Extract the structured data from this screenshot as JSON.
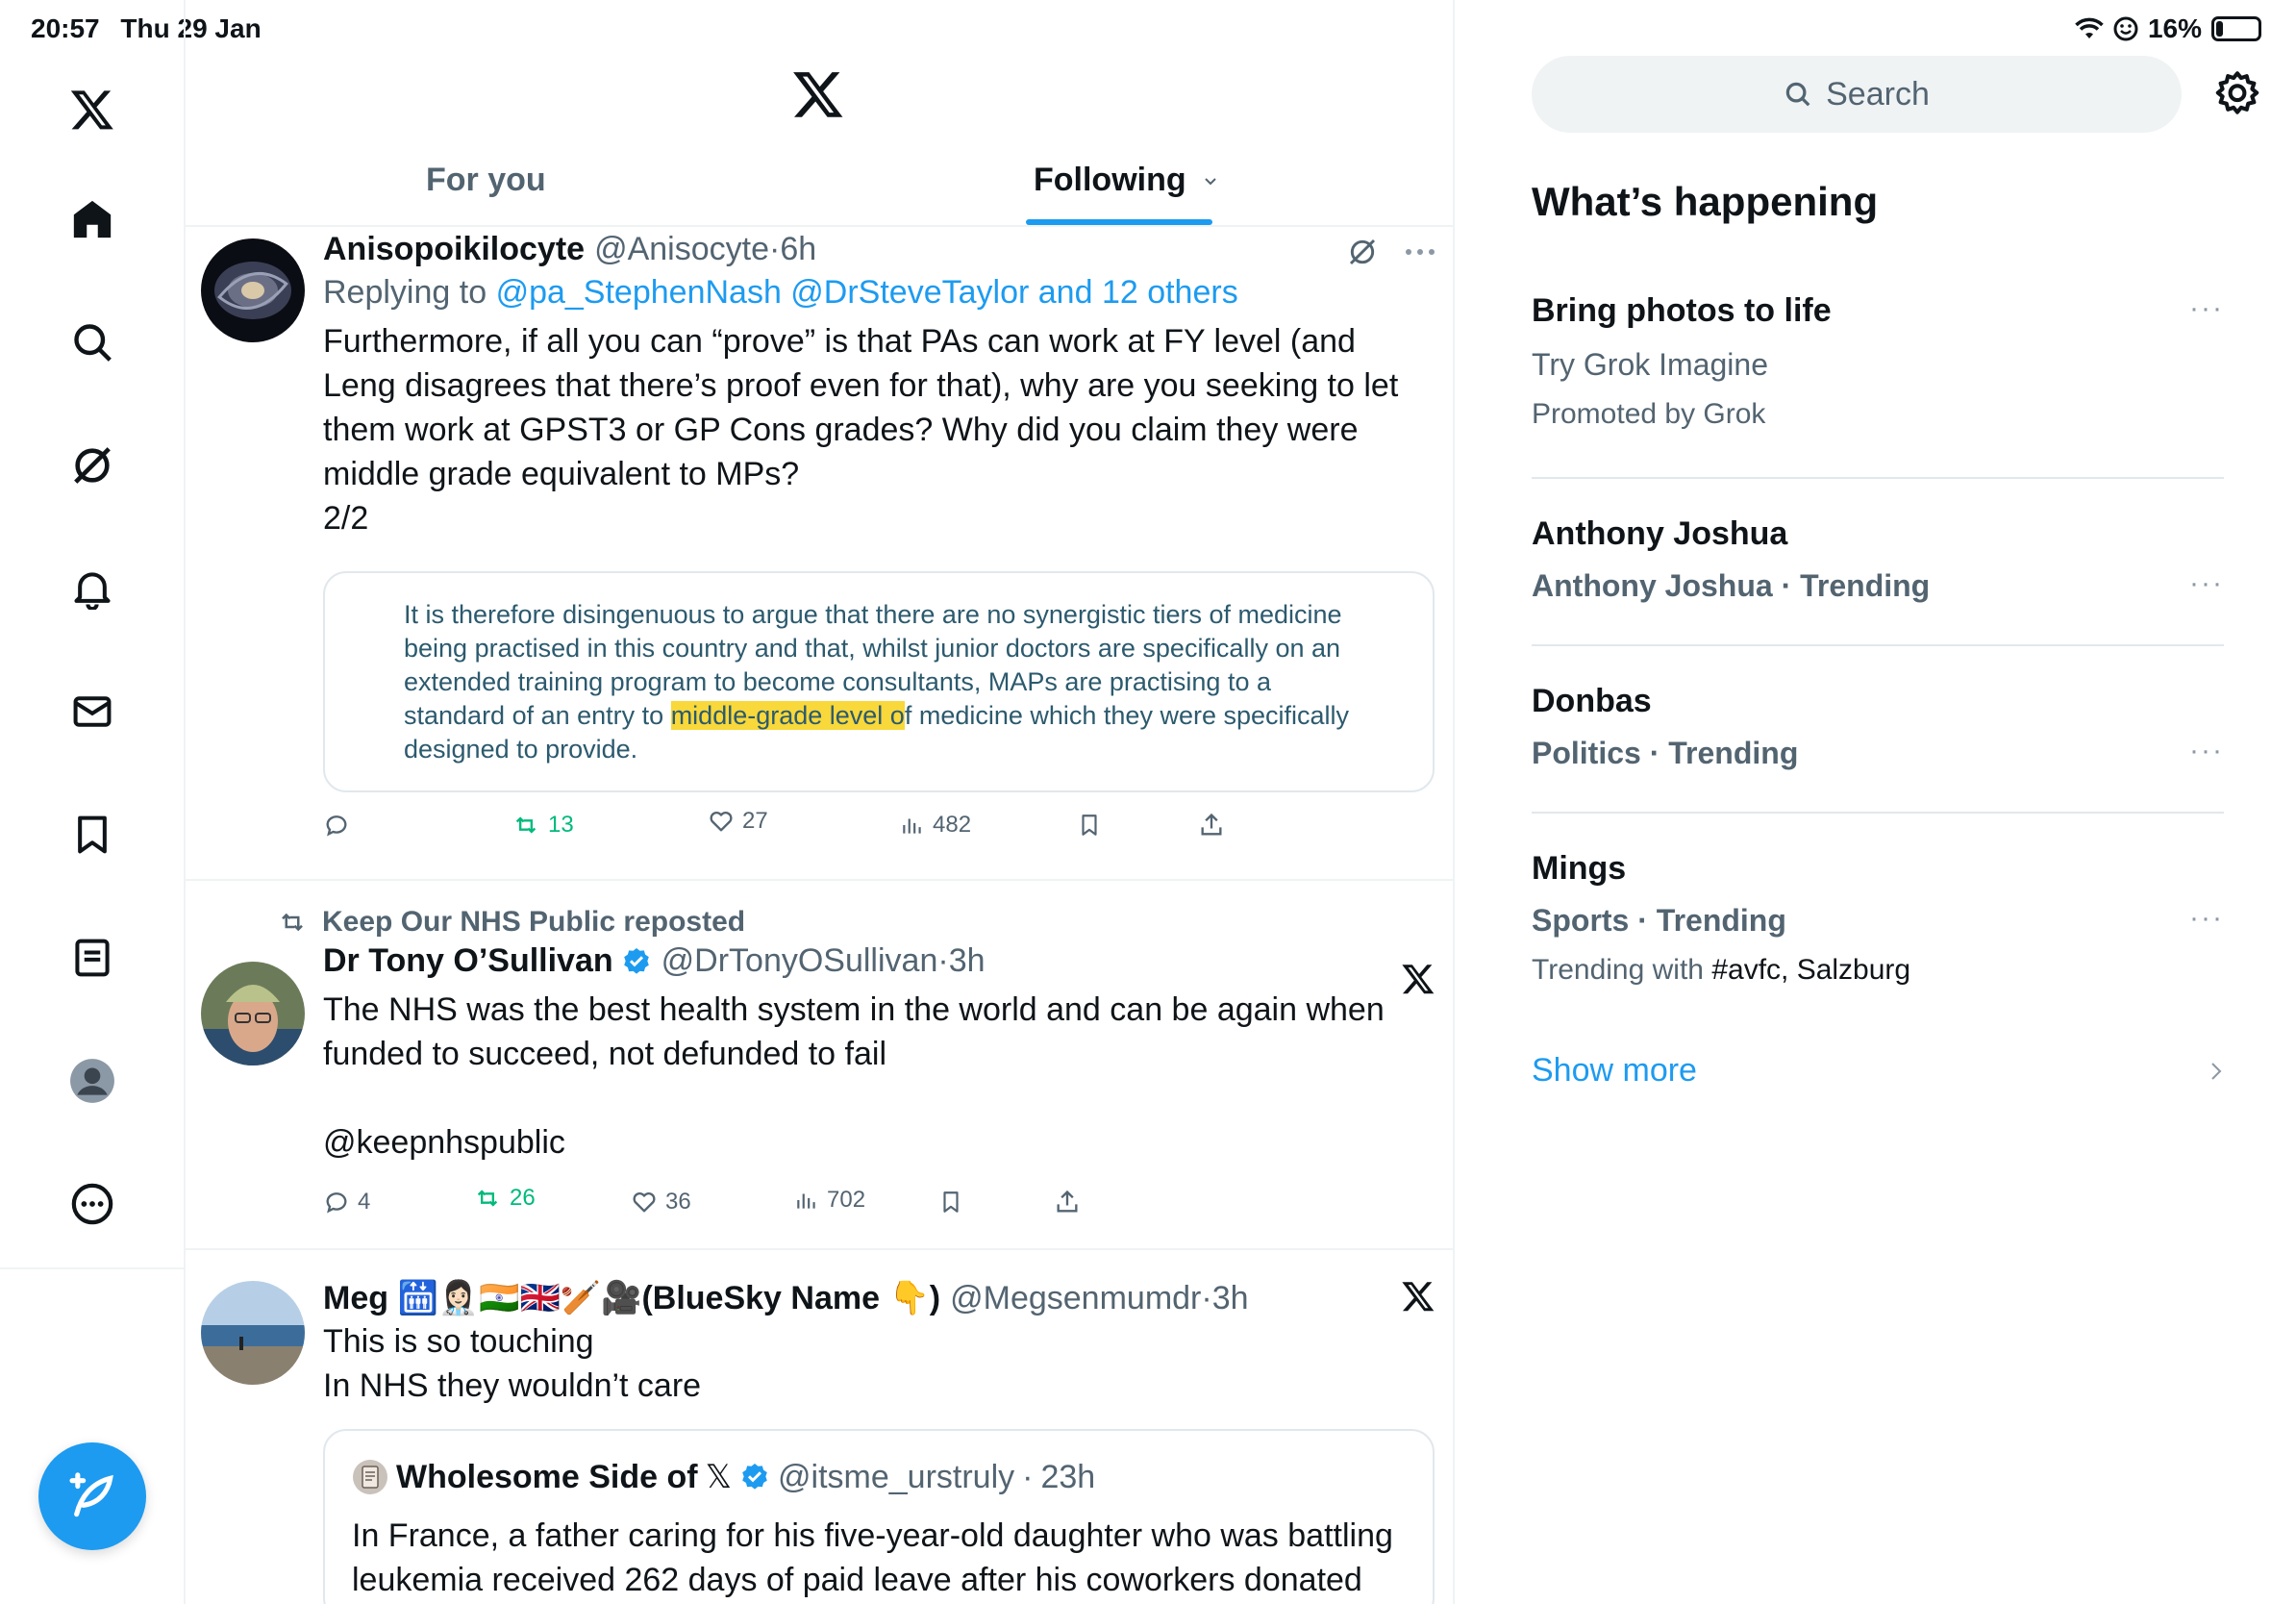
{
  "status_bar": {
    "time": "20:57",
    "date": "Thu 29 Jan",
    "battery": "16%",
    "battery_level": 0.16
  },
  "tabs": [
    {
      "label": "For you"
    },
    {
      "label": "Following"
    }
  ],
  "tweets": [
    {
      "name": "Anisopoikilocyte",
      "handle": "@Anisocyte",
      "time": "6h",
      "reply_prefix": "Replying to",
      "reply_to": "@pa_StephenNash @DrSteveTaylor and 12 others",
      "text": "Furthermore, if all you can “prove” is that PAs can work at FY level (and Leng disagrees that there’s proof even for that), why are you seeking to let them work at GPST3 or GP Cons grades? Why did you claim they were middle grade equivalent to MPs?",
      "text2": "2/2",
      "image_text_before": "It is therefore disingenuous to argue that there are no synergistic tiers of medicine being practised in this country and that, whilst junior doctors are specifically on an extended training program to become consultants, MAPs are practising to a standard of an entry to ",
      "image_text_highlight": "middle-grade level o",
      "image_text_after": "f medicine which they were specifically designed to provide.",
      "reposts": "13",
      "likes": "27",
      "views": "482"
    },
    {
      "reposted_by": "Keep Our NHS Public reposted",
      "name": "Dr Tony O’Sullivan",
      "handle": "@DrTonyOSullivan",
      "time": "3h",
      "text": "The NHS was the best health system in the world and can be again when funded to succeed, not defunded to fail",
      "mention": "@keepnhspublic",
      "replies": "4",
      "reposts": "26",
      "likes": "36",
      "views": "702"
    },
    {
      "name": "Meg 🛗👩🏻‍⚕️🇮🇳🇬🇧🏏🎥(BlueSky Name 👇)",
      "handle": "@Megsenmumdr",
      "time": "3h",
      "text1": "This is so touching",
      "text2": "In NHS they wouldn’t care",
      "quote": {
        "name": "Wholesome Side of",
        "name_suffix": "𝕏",
        "handle": "@itsme_urstruly",
        "time": "23h",
        "text": "In France, a father caring for his five-year-old daughter who was battling leukemia received 262 days of paid leave after his coworkers donated"
      }
    }
  ],
  "sidebar": {
    "search_placeholder": "Search",
    "title": "What’s happening",
    "trends": [
      {
        "title": "Bring photos to life",
        "sub": "Try Grok Imagine",
        "meta": "Promoted by Grok"
      },
      {
        "title": "Anthony Joshua",
        "sub": "Anthony Joshua · Trending"
      },
      {
        "title": "Donbas",
        "sub": "Politics · Trending"
      },
      {
        "title": "Mings",
        "sub": "Sports · Trending",
        "meta_prefix": "Trending with",
        "meta_tags": "#avfc, Salzburg"
      }
    ],
    "show_more": "Show more"
  },
  "colors": {
    "accent": "#1d9bf0",
    "repost_green": "#00ba7c",
    "secondary_text": "#536471"
  }
}
